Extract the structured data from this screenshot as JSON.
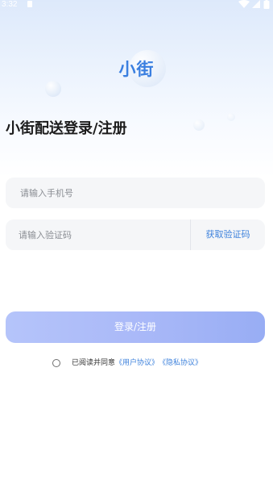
{
  "status_bar": {
    "time": "3:32"
  },
  "logo": {
    "text": "小街"
  },
  "page": {
    "title": "小街配送登录/注册"
  },
  "phone": {
    "placeholder": "请输入手机号",
    "value": ""
  },
  "code": {
    "placeholder": "请输入验证码",
    "value": "",
    "get_code_label": "获取验证码"
  },
  "login": {
    "button_label": "登录/注册"
  },
  "agreement": {
    "checked": false,
    "text": "已阅读并同意",
    "user_agreement": "《用户协议》",
    "privacy_policy": "《隐私协议》"
  },
  "colors": {
    "accent": "#3e82dc",
    "button_gradient_start": "#b5c4fa",
    "button_gradient_end": "#98adf4",
    "field_background": "#f5f6f8"
  }
}
